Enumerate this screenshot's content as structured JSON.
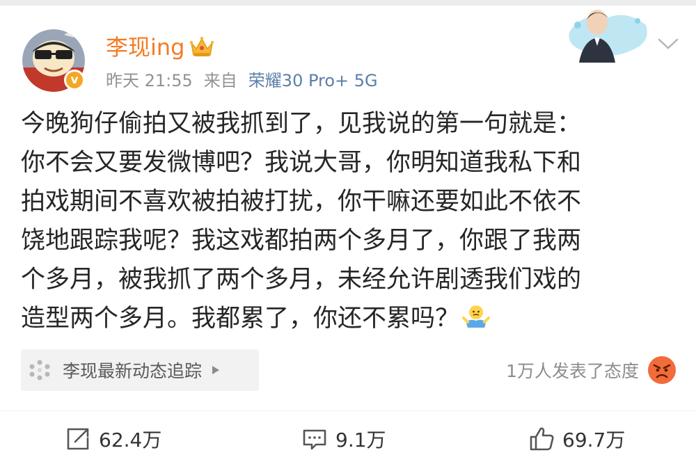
{
  "post": {
    "author": {
      "name": "李现ing",
      "avatar_icon": "cartoon-avatar-icon",
      "verified_icon": "verified-v-icon",
      "verified_text": "v",
      "vip_icon": "crown-icon"
    },
    "meta": {
      "time": "昨天 21:55",
      "source_prefix": "来自",
      "device": "荣耀30 Pro+ 5G"
    },
    "content_lines": [
      "今晚狗仔偷拍又被我抓到了，见我说的第一句就是：",
      "你不会又要发微博吧？我说大哥，你明知道我私下和",
      "拍戏期间不喜欢被拍被打扰，你干嘛还要如此不依不",
      "饶地跟踪我呢？我这戏都拍两个多月了，你跟了我两",
      "个多月，被我抓了两个多月，未经允许剧透我们戏的",
      "造型两个多月。我都累了，你还不累吗？"
    ],
    "content_emoji": "shrug-emoji-icon",
    "topic": {
      "icon": "topic-dots-icon",
      "label": "李现最新动态追踪",
      "arrow": "play-arrow-icon"
    },
    "reaction": {
      "text": "1万人发表了态度",
      "icon": "angry-face-icon"
    },
    "actions": {
      "reposts": "62.4万",
      "comments": "9.1万",
      "likes": "69.7万"
    }
  },
  "colors": {
    "username": "#f47b23",
    "meta": "#939393",
    "device": "#5b7fa8",
    "text": "#262626",
    "chip_bg": "#f2f2f2",
    "verified": "#f5a623"
  },
  "header": {
    "banner_icon": "celebrity-banner-image",
    "menu_icon": "chevron-down-icon"
  }
}
